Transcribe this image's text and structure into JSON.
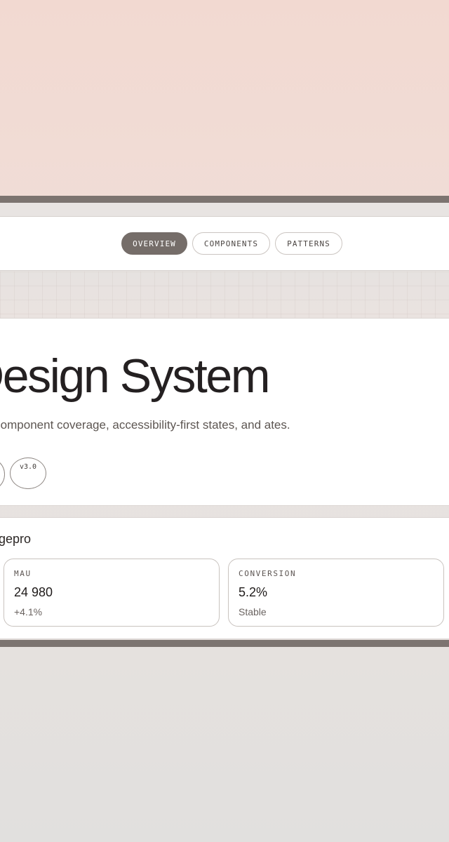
{
  "nav": {
    "tabs": [
      {
        "label": "OVERVIEW",
        "active": true
      },
      {
        "label": "COMPONENTS",
        "active": false
      },
      {
        "label": "PATTERNS",
        "active": false
      }
    ]
  },
  "hero": {
    "title": "Design System",
    "description": "n component coverage, accessibility-first states, and ates.",
    "badges": [
      "",
      "v3.0"
    ]
  },
  "stats": {
    "heading": "rgepro",
    "cards": [
      {
        "label": "MAU",
        "value": "24 980",
        "note": "+4.1%"
      },
      {
        "label": "CONVERSION",
        "value": "5.2%",
        "note": "Stable"
      }
    ]
  },
  "colors": {
    "accent": "#756d69",
    "background_top": "#f2d9d1",
    "background_bottom": "#e1e0de",
    "surface": "#ffffff",
    "border": "#c9c3bf"
  }
}
